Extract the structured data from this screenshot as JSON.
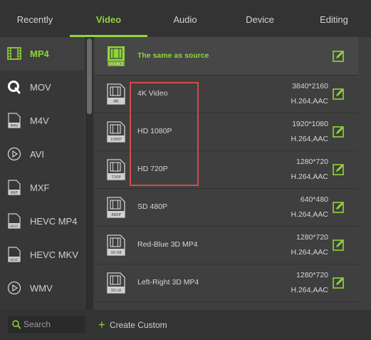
{
  "tabs": [
    {
      "label": "Recently",
      "active": false
    },
    {
      "label": "Video",
      "active": true
    },
    {
      "label": "Audio",
      "active": false
    },
    {
      "label": "Device",
      "active": false
    },
    {
      "label": "Editing",
      "active": false
    }
  ],
  "sidebar": {
    "items": [
      {
        "label": "MP4",
        "icon": "film-icon",
        "active": true
      },
      {
        "label": "MOV",
        "icon": "quicktime-icon",
        "active": false
      },
      {
        "label": "M4V",
        "icon": "m4v-file-icon",
        "icon_text": "M4V",
        "active": false
      },
      {
        "label": "AVI",
        "icon": "play-circle-icon",
        "active": false
      },
      {
        "label": "MXF",
        "icon": "mxf-file-icon",
        "icon_text": "MXF",
        "active": false
      },
      {
        "label": "HEVC MP4",
        "icon": "hevc-file-icon",
        "icon_text": "HEVC",
        "active": false
      },
      {
        "label": "HEVC MKV",
        "icon": "hevc-file-icon",
        "icon_text": "HEVC",
        "active": false
      },
      {
        "label": "WMV",
        "icon": "play-circle-icon",
        "active": false
      }
    ]
  },
  "presets": [
    {
      "name": "The same as source",
      "badge": "SOURCE",
      "resolution": "",
      "codec": "",
      "selected": true
    },
    {
      "name": "4K Video",
      "badge": "4K",
      "resolution": "3840*2160",
      "codec": "H.264,AAC",
      "selected": false
    },
    {
      "name": "HD 1080P",
      "badge": "1080P",
      "resolution": "1920*1080",
      "codec": "H.264,AAC",
      "selected": false
    },
    {
      "name": "HD 720P",
      "badge": "720P",
      "resolution": "1280*720",
      "codec": "H.264,AAC",
      "selected": false
    },
    {
      "name": "SD 480P",
      "badge": "480P",
      "resolution": "640*480",
      "codec": "H.264,AAC",
      "selected": false
    },
    {
      "name": "Red-Blue 3D MP4",
      "badge": "3D RB",
      "resolution": "1280*720",
      "codec": "H.264,AAC",
      "selected": false
    },
    {
      "name": "Left-Right 3D MP4",
      "badge": "3D LR",
      "resolution": "1280*720",
      "codec": "H.264,AAC",
      "selected": false
    }
  ],
  "search": {
    "placeholder": "Search"
  },
  "create_custom": {
    "label": "Create Custom"
  },
  "colors": {
    "accent": "#8fd63a",
    "highlight_box": "#d34b4b",
    "background": "#3c3c3c"
  }
}
